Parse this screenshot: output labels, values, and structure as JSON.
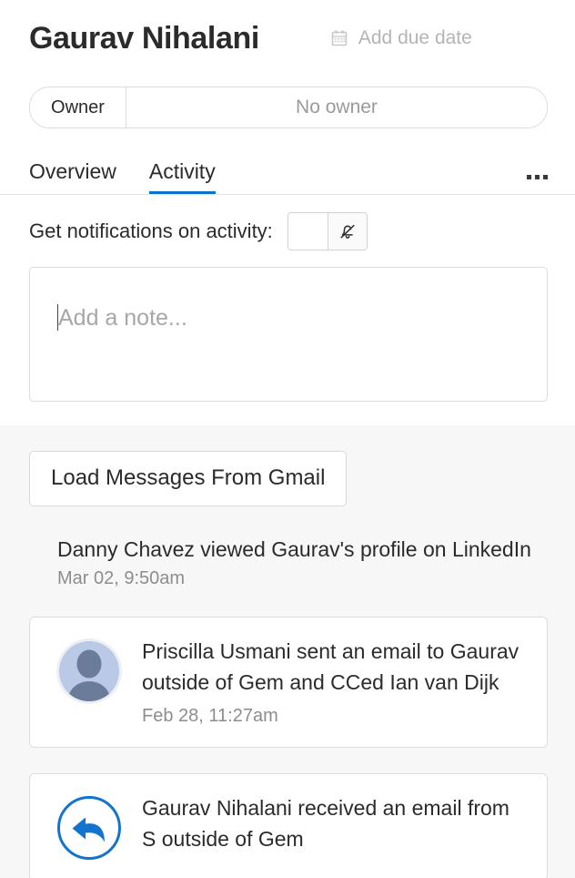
{
  "header": {
    "profile_name": "Gaurav Nihalani",
    "due_date_label": "Add due date",
    "calendar_icon": "calendar-icon"
  },
  "owner": {
    "label": "Owner",
    "value": "No owner"
  },
  "tabs": {
    "items": [
      {
        "label": "Overview",
        "active": false
      },
      {
        "label": "Activity",
        "active": true
      }
    ],
    "overflow_icon": "ellipsis-icon",
    "active_underline_color": "#0b72d0"
  },
  "notifications": {
    "label": "Get notifications on activity:",
    "on_segment_icon": "bell-icon",
    "off_segment_icon": "bell-slash-icon",
    "selected": "off"
  },
  "note": {
    "placeholder": "Add a note...",
    "value": "",
    "caret_visible": true
  },
  "activity": {
    "load_button_label": "Load Messages From Gmail",
    "items": [
      {
        "kind": "plain",
        "icon": "none",
        "text": "Danny Chavez viewed Gaurav's profile on LinkedIn",
        "time": "Mar 02, 9:50am"
      },
      {
        "kind": "card",
        "icon": "avatar-placeholder-icon",
        "text": "Priscilla Usmani sent an email to Gaurav outside of Gem and CCed Ian van Dijk",
        "time": "Feb 28, 11:27am"
      },
      {
        "kind": "card",
        "icon": "reply-arrow-icon",
        "text": "Gaurav Nihalani received an email from S outside of Gem",
        "time": ""
      }
    ]
  },
  "colors": {
    "accent_blue": "#0b72d0",
    "reply_blue": "#1274cf",
    "page_bg": "#ffffff",
    "activity_bg": "#f7f7f7",
    "muted_text": "#8d8d8d",
    "placeholder_text": "#a7a7a7"
  }
}
